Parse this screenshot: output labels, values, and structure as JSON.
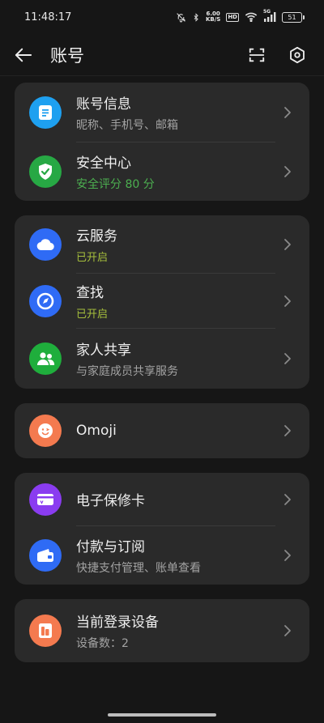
{
  "status_bar": {
    "time": "11:48:17",
    "net_speed_value": "6.00",
    "net_speed_unit": "KB/S",
    "hd_badge": "HD",
    "network_type": "5G",
    "battery_level": "51"
  },
  "header": {
    "title": "账号"
  },
  "groups": [
    {
      "items": [
        {
          "title": "账号信息",
          "subtitle": "昵称、手机号、邮箱",
          "icon": "document-icon",
          "color": "#1ea0f0"
        },
        {
          "title": "安全中心",
          "subtitle": "安全评分 80 分",
          "icon": "shield-icon",
          "color": "#27a844"
        }
      ]
    },
    {
      "items": [
        {
          "title": "云服务",
          "subtitle": "已开启",
          "icon": "cloud-icon",
          "color": "#2f6bf5"
        },
        {
          "title": "查找",
          "subtitle": "已开启",
          "icon": "compass-icon",
          "color": "#2f6bf5"
        },
        {
          "title": "家人共享",
          "subtitle": "与家庭成员共享服务",
          "icon": "people-icon",
          "color": "#1fae3c"
        }
      ]
    },
    {
      "items": [
        {
          "title": "Omoji",
          "icon": "omoji-face-icon",
          "color": "#f47a4f"
        }
      ]
    },
    {
      "items": [
        {
          "title": "电子保修卡",
          "icon": "warranty-card-icon",
          "color": "#8a3cf0"
        },
        {
          "title": "付款与订阅",
          "subtitle": "快捷支付管理、账单查看",
          "icon": "wallet-icon",
          "color": "#2f6bf5"
        }
      ]
    },
    {
      "items": [
        {
          "title": "当前登录设备",
          "subtitle": "设备数：2",
          "icon": "devices-icon",
          "color": "#f47a4f"
        }
      ]
    }
  ]
}
